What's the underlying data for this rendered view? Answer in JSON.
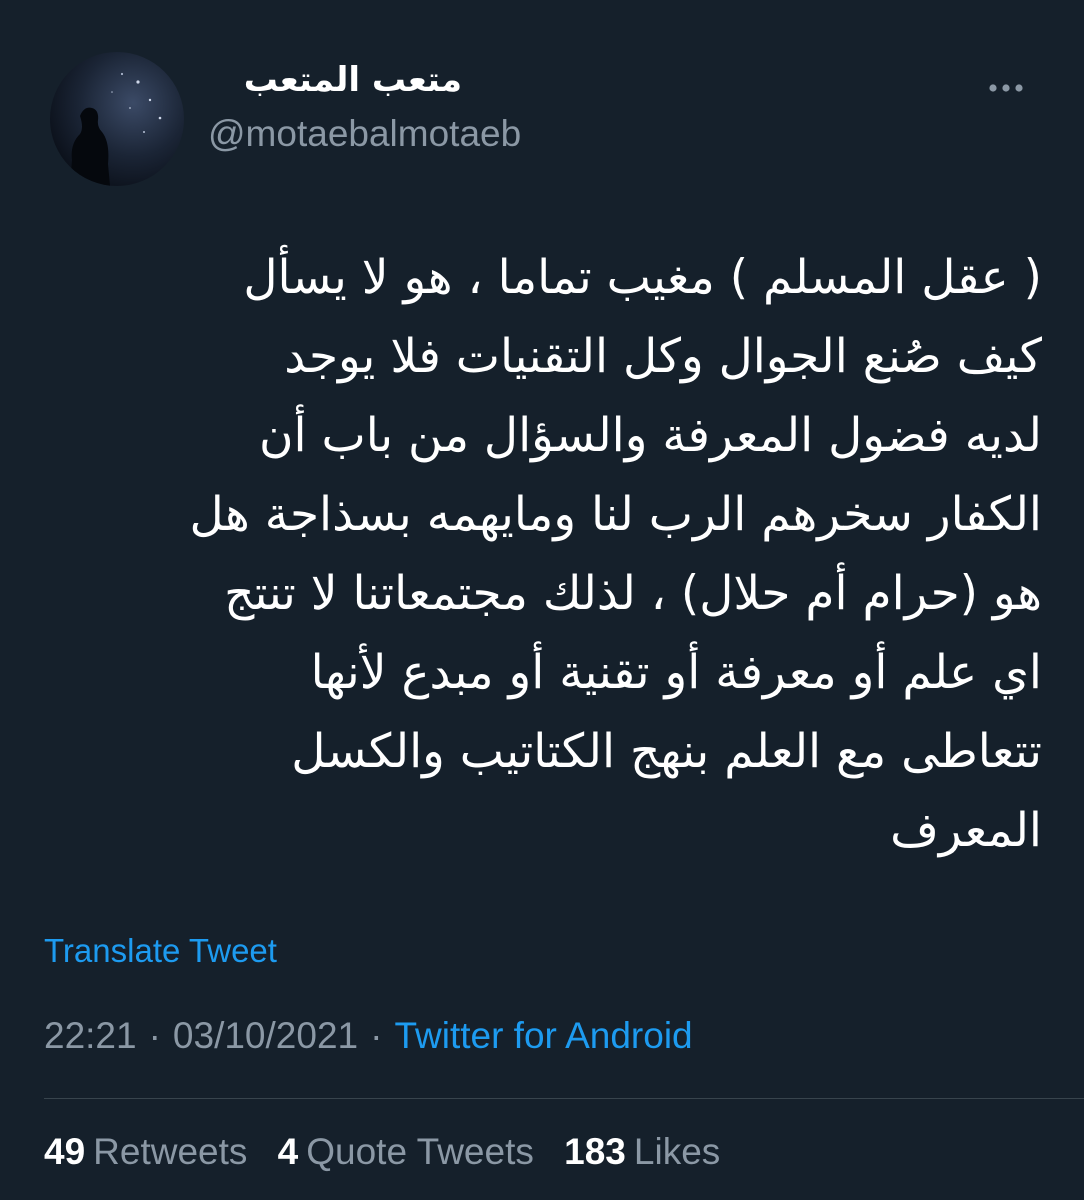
{
  "author": {
    "display_name": "متعب المتعب",
    "handle": "@motaebalmotaeb",
    "avatar_icon": "night-sky-silhouette-avatar"
  },
  "more_icon": "more-horizontal-icon",
  "tweet": {
    "lines": [
      "( عقل المسلم ) مغيب تماما ، هو لا يسأل",
      "كيف صُنع الجوال وكل التقنيات فلا يوجد",
      "لديه فضول المعرفة والسؤال من باب أن",
      "الكفار سخرهم الرب لنا ومايهمه بسذاجة هل",
      "هو (حرام أم حلال) ، لذلك مجتمعاتنا لا تنتج",
      "اي علم أو معرفة أو تقنية أو مبدع لأنها",
      "تتعاطى مع العلم بنهج الكتاتيب والكسل",
      "المعرف"
    ],
    "translate_label": "Translate Tweet"
  },
  "meta": {
    "time": "22:21",
    "separator": "·",
    "date": "03/10/2021",
    "source": "Twitter for Android"
  },
  "stats": {
    "retweets_count": "49",
    "retweets_label": "Retweets",
    "quote_count": "4",
    "quote_label": "Quote Tweets",
    "likes_count": "183",
    "likes_label": "Likes"
  },
  "colors": {
    "background": "#15202b",
    "text": "#ffffff",
    "secondary": "#8b98a5",
    "accent": "#1d9bf0",
    "divider": "#38444d"
  }
}
